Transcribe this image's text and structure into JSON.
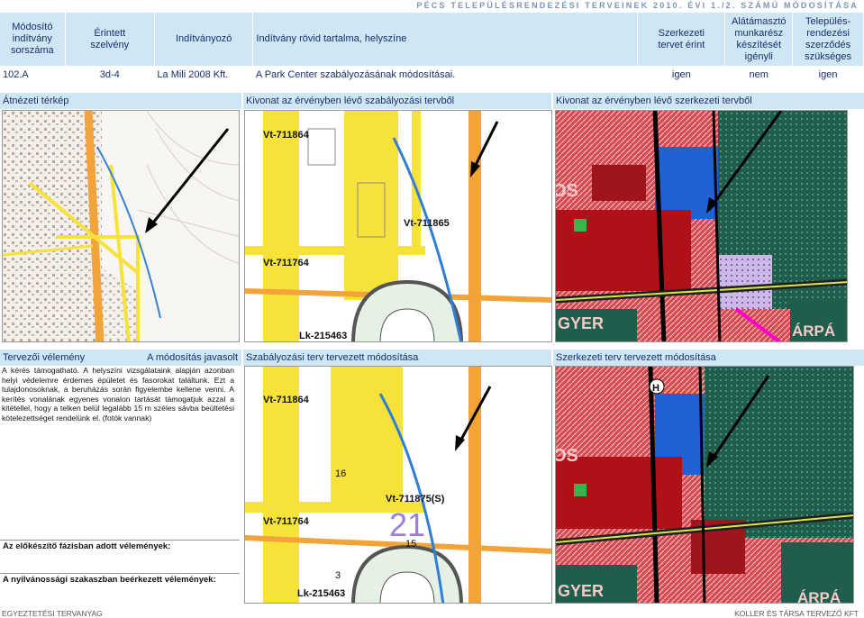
{
  "header_strip": "PÉCS TELEPÜLÉSRENDEZÉSI TERVEINEK 2010. ÉVI 1./2. SZÁMÚ MÓDOSÍTÁSA",
  "columns": [
    {
      "line1": "Módosító",
      "line2": "indítvány",
      "line3": "sorszáma"
    },
    {
      "line1": "Érintett",
      "line2": "szelvény"
    },
    {
      "line1": "Indítványozó"
    },
    {
      "line1": "Indítvány rövid tartalma, helyszíne"
    },
    {
      "line1": "Szerkezeti",
      "line2": "tervet érint"
    },
    {
      "line1": "Alátámasztó",
      "line2": "munkarész",
      "line3": "készítését",
      "line4": "igényli"
    },
    {
      "line1": "Település-",
      "line2": "rendezési",
      "line3": "szerződés",
      "line4": "szükséges"
    }
  ],
  "row": {
    "id": "102.A",
    "sheet": "3d-4",
    "proposer": "La Mili 2008 Kft.",
    "content": "A Park Center szabályozásának módosításai.",
    "structural": "igen",
    "supporting": "nem",
    "contract": "igen"
  },
  "sections": {
    "overview": "Átnézeti térkép",
    "reg_extract": "Kivonat az érvényben lévő szabályozási tervből",
    "struct_extract": "Kivonat az érvényben lévő szerkezeti tervből",
    "planner_opinion": "Tervezői vélemény",
    "suggested": "A módosítás javasolt",
    "reg_change": "Szabályozási terv tervezett módosítása",
    "struct_change": "Szerkezeti terv tervezett módosítása"
  },
  "opinion_text": "A kérés támogatható. A helyszíni vizsgálataink alapján azonban helyi védelemre érdemes épületet és fasorokat találtunk. Ezt a tulajdonosoknak, a beruházás során figyelembe kellene venni. A kerítés vonalának egyenes vonalon tartását támogatjuk azzal a kitétellel, hogy a telken belül legalább 15 m széles sávba beültetési kötelezettséget rendelünk el. (fotók vannak)",
  "preliminary_label": "Az előkészítő fázisban adott vélemények:",
  "public_label": "A nyilvánossági szakaszban beérkezett vélemények:",
  "footer_left": "EGYEZTETÉSI TERVANYAG",
  "footer_right": "KOLLER ÉS TÁRSA TERVEZŐ KFT",
  "map_labels": {
    "vt1": "Vt-711864",
    "vt2": "Vt-711865",
    "vt3": "Vt-711764",
    "lk": "Lk-215463",
    "vt_new": "Vt-711875(S)",
    "num21": "21",
    "num16": "16",
    "num15": "15",
    "num3": "3",
    "os": "OS",
    "gyer": "GYER",
    "arpa": "ÁRPÁ",
    "h": "H"
  },
  "colors": {
    "header_bg": "#cfe6f5",
    "header_text": "#16306b",
    "road_yellow": "#f7e23a",
    "road_orange": "#f2a33a",
    "map_red": "#c2141d",
    "map_green": "#1f5e4d",
    "map_blue": "#1e62d6"
  }
}
